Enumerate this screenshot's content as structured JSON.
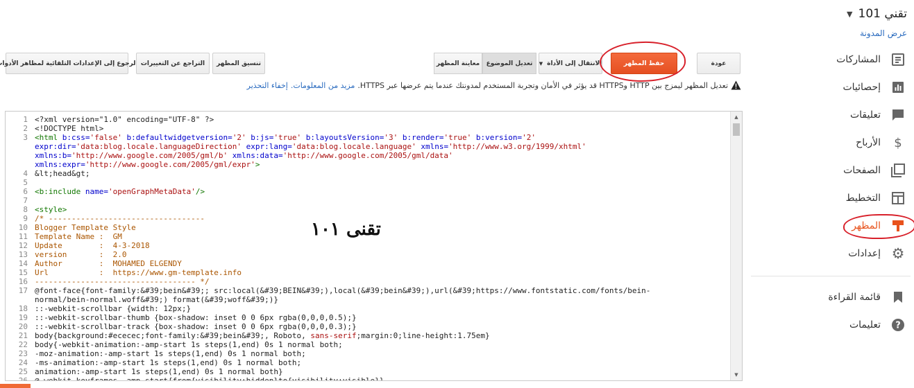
{
  "sidebar": {
    "blog_title": "تقني 101",
    "view_blog": "عرض المدونة",
    "items": [
      {
        "label": "المشاركات",
        "icon": "posts-icon"
      },
      {
        "label": "إحصائيات",
        "icon": "stats-icon"
      },
      {
        "label": "تعليقات",
        "icon": "comments-icon"
      },
      {
        "label": "الأرباح",
        "icon": "dollar-icon"
      },
      {
        "label": "الصفحات",
        "icon": "pages-icon"
      },
      {
        "label": "التخطيط",
        "icon": "layout-icon"
      },
      {
        "label": "المظهر",
        "icon": "theme-icon",
        "active": true
      },
      {
        "label": "إعدادات",
        "icon": "gear-icon"
      }
    ],
    "secondary": [
      {
        "label": "قائمة القراءة",
        "icon": "bookmark-icon"
      },
      {
        "label": "تعليمات",
        "icon": "help-icon"
      }
    ]
  },
  "toolbar": {
    "back": "عودة",
    "save_theme": "حفظ المظهر",
    "jump_to_widget": "الانتقال إلى الأداة",
    "edit_theme": "تعديل الموضوع",
    "preview_theme": "معاينة المظهر",
    "format_theme": "تنسيق المظهر",
    "revert_changes": "التراجع عن التغييرات",
    "revert_widget_defaults": "الرجوع إلى الإعدادات التلقائية لمظاهر الأدوات"
  },
  "warning": {
    "text": "تعديل المظهر ليمزج بين HTTP وHTTPS قد يؤثر في الأمان وتجربة المستخدم لمدونتك عندما يتم عرضها عبر HTTPS.",
    "learn_more": "مزيد من المعلومات.",
    "hide": "إخفاء التحذير"
  },
  "editor": {
    "watermark": "تقنى ١٠١",
    "lines": [
      {
        "n": "1",
        "parts": [
          [
            "c-plain",
            "<?xml version=\"1.0\" encoding=\"UTF-8\" ?>"
          ]
        ]
      },
      {
        "n": "2",
        "parts": [
          [
            "c-plain",
            "<!DOCTYPE html>"
          ]
        ]
      },
      {
        "n": "3",
        "parts": [
          [
            "c-tag",
            "<html "
          ],
          [
            "c-attr",
            "b:css="
          ],
          [
            "c-str",
            "'false'"
          ],
          [
            "c-attr",
            " b:defaultwidgetversion="
          ],
          [
            "c-str",
            "'2'"
          ],
          [
            "c-attr",
            " b:js="
          ],
          [
            "c-str",
            "'true'"
          ],
          [
            "c-attr",
            " b:layoutsVersion="
          ],
          [
            "c-str",
            "'3'"
          ],
          [
            "c-attr",
            " b:render="
          ],
          [
            "c-str",
            "'true'"
          ],
          [
            "c-attr",
            " b:version="
          ],
          [
            "c-str",
            "'2'"
          ]
        ]
      },
      {
        "n": "",
        "parts": [
          [
            "c-attr",
            "expr:dir="
          ],
          [
            "c-str",
            "'data:blog.locale.languageDirection'"
          ],
          [
            "c-attr",
            " expr:lang="
          ],
          [
            "c-str",
            "'data:blog.locale.language'"
          ],
          [
            "c-attr",
            " xmlns="
          ],
          [
            "c-str",
            "'http://www.w3.org/1999/xhtml'"
          ]
        ]
      },
      {
        "n": "",
        "parts": [
          [
            "c-attr",
            "xmlns:b="
          ],
          [
            "c-str",
            "'http://www.google.com/2005/gml/b'"
          ],
          [
            "c-attr",
            " xmlns:data="
          ],
          [
            "c-str",
            "'http://www.google.com/2005/gml/data'"
          ]
        ]
      },
      {
        "n": "",
        "parts": [
          [
            "c-attr",
            "xmlns:expr="
          ],
          [
            "c-str",
            "'http://www.google.com/2005/gml/expr'"
          ],
          [
            "c-tag",
            ">"
          ]
        ]
      },
      {
        "n": "4",
        "parts": [
          [
            "c-plain",
            "&lt;head&gt;"
          ]
        ]
      },
      {
        "n": "5",
        "parts": [
          [
            "c-plain",
            ""
          ]
        ]
      },
      {
        "n": "6",
        "parts": [
          [
            "c-tag",
            "<b:include "
          ],
          [
            "c-attr",
            "name="
          ],
          [
            "c-str",
            "'openGraphMetaData'"
          ],
          [
            "c-tag",
            "/>"
          ]
        ]
      },
      {
        "n": "7",
        "parts": [
          [
            "c-plain",
            ""
          ]
        ]
      },
      {
        "n": "8",
        "parts": [
          [
            "c-tag",
            "<style>"
          ]
        ]
      },
      {
        "n": "9",
        "parts": [
          [
            "c-com",
            "/* ----------------------------------"
          ]
        ]
      },
      {
        "n": "10",
        "parts": [
          [
            "c-com",
            "Blogger Template Style"
          ]
        ]
      },
      {
        "n": "11",
        "parts": [
          [
            "c-com",
            "Template Name :  GM"
          ]
        ]
      },
      {
        "n": "12",
        "parts": [
          [
            "c-com",
            "Update        :  4-3-2018"
          ]
        ]
      },
      {
        "n": "13",
        "parts": [
          [
            "c-com",
            "version       :  2.0"
          ]
        ]
      },
      {
        "n": "14",
        "parts": [
          [
            "c-com",
            "Author        :  MOHAMED ELGENDY"
          ]
        ]
      },
      {
        "n": "15",
        "parts": [
          [
            "c-com",
            "Url           :  https://www.gm-template.info"
          ]
        ]
      },
      {
        "n": "16",
        "parts": [
          [
            "c-com",
            "----------------------------------- */"
          ]
        ]
      },
      {
        "n": "17",
        "parts": [
          [
            "c-plain",
            "@font-face{font-family:&#39;bein&#39;; src:local(&#39;BEIN&#39;),local(&#39;bein&#39;),url(&#39;https://www.fontstatic.com/fonts/bein-"
          ]
        ]
      },
      {
        "n": "",
        "parts": [
          [
            "c-plain",
            "normal/bein-normal.woff&#39;) format(&#39;woff&#39;)}"
          ]
        ]
      },
      {
        "n": "18",
        "parts": [
          [
            "c-plain",
            "::-webkit-scrollbar {width: 12px;}"
          ]
        ]
      },
      {
        "n": "19",
        "parts": [
          [
            "c-plain",
            "::-webkit-scrollbar-thumb {box-shadow: inset 0 0 6px rgba(0,0,0,0.5);}"
          ]
        ]
      },
      {
        "n": "20",
        "parts": [
          [
            "c-plain",
            "::-webkit-scrollbar-track {box-shadow: inset 0 0 6px rgba(0,0,0,0.3);}"
          ]
        ]
      },
      {
        "n": "21",
        "parts": [
          [
            "c-plain",
            "body{background:#ececec;font-family:&#39;bein&#39;, Roboto, "
          ],
          [
            "c-str",
            "sans-serif"
          ],
          [
            "c-plain",
            ";margin:0;line-height:1.75em}"
          ]
        ]
      },
      {
        "n": "22",
        "parts": [
          [
            "c-plain",
            "body{-webkit-animation:-amp-start 1s steps(1,end) 0s 1 normal both;"
          ]
        ]
      },
      {
        "n": "23",
        "parts": [
          [
            "c-plain",
            "-moz-animation:-amp-start 1s steps(1,end) 0s 1 normal both;"
          ]
        ]
      },
      {
        "n": "24",
        "parts": [
          [
            "c-plain",
            "-ms-animation:-amp-start 1s steps(1,end) 0s 1 normal both;"
          ]
        ]
      },
      {
        "n": "25",
        "parts": [
          [
            "c-plain",
            "animation:-amp-start 1s steps(1,end) 0s 1 normal both}"
          ]
        ]
      },
      {
        "n": "26",
        "parts": [
          [
            "c-plain",
            "@-webkit-keyframes -amp-start{from{visibility:hidden}to{visibility:visible}}"
          ]
        ]
      }
    ]
  },
  "colors": {
    "accent": "#e8521c",
    "link": "#2a6bbf",
    "annotation": "#d8202a"
  }
}
